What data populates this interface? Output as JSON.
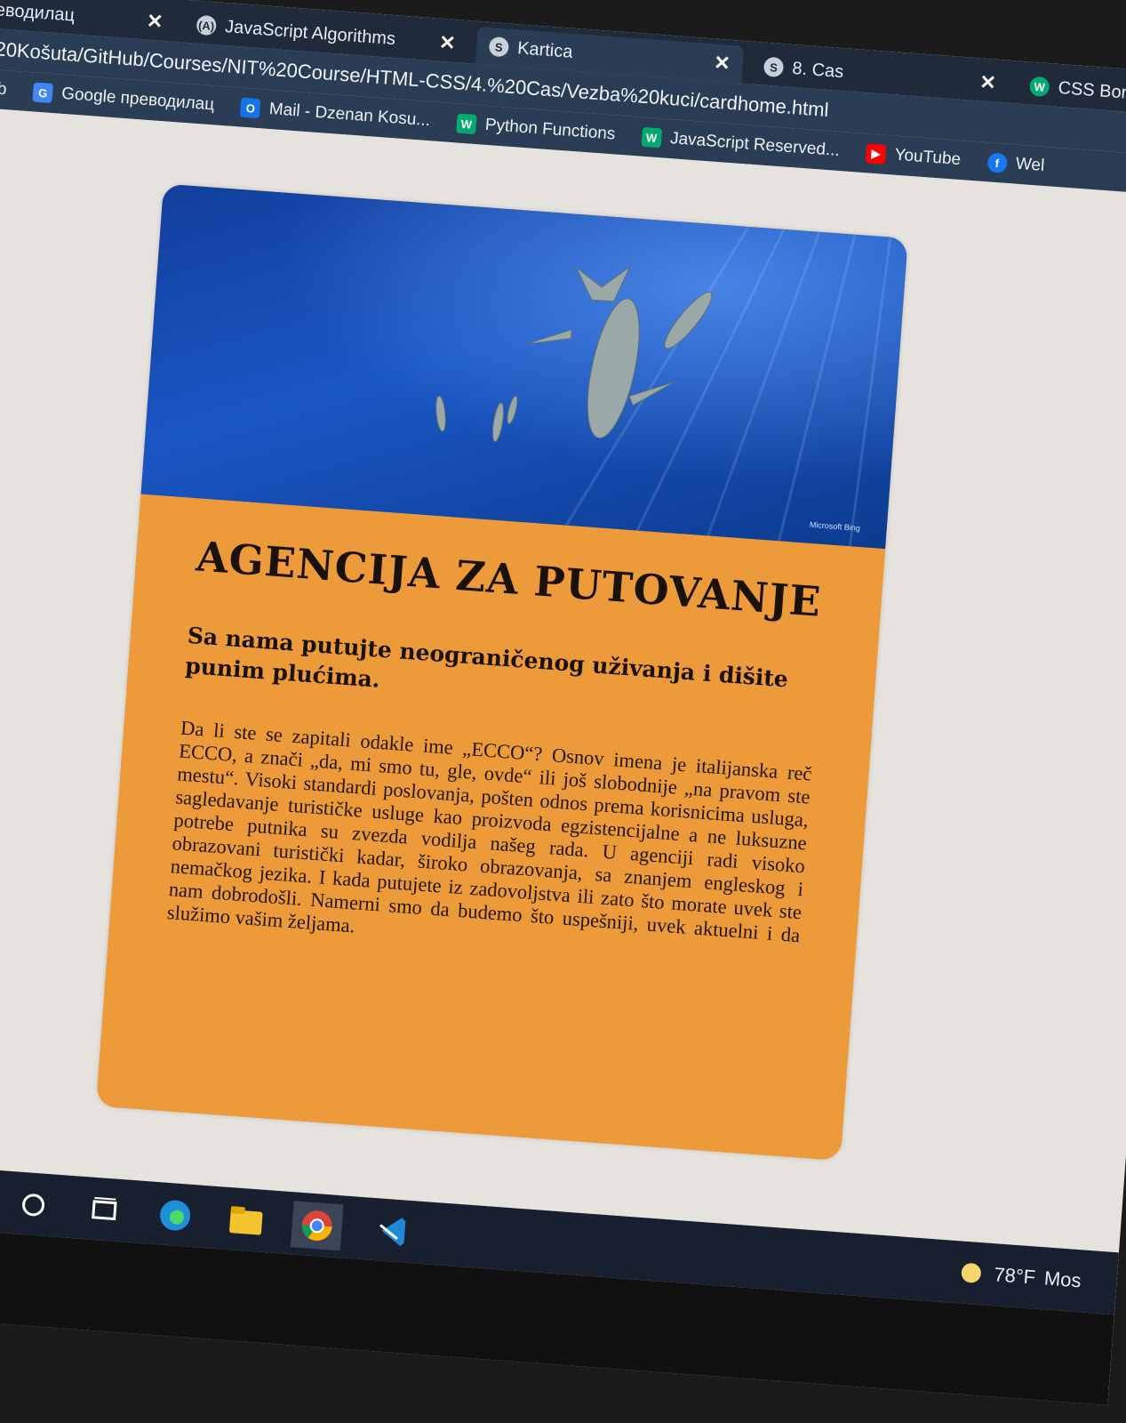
{
  "tabs": [
    {
      "label": "ie преводилац",
      "icon": "",
      "close": "✕"
    },
    {
      "label": "JavaScript Algorithms",
      "icon": "(A)",
      "close": "✕"
    },
    {
      "label": "Kartica",
      "icon": "S",
      "close": "✕"
    },
    {
      "label": "8. Cas",
      "icon": "S",
      "close": "✕"
    },
    {
      "label": "CSS Bord",
      "icon": "W",
      "close": ""
    }
  ],
  "address": {
    "url": "20Košuta/GitHub/Courses/NIT%20Course/HTML-CSS/4.%20Cas/Vezba%20kuci/cardhome.html"
  },
  "bookmarks": [
    {
      "label": "ub",
      "icon": "",
      "color": "#2b3d55"
    },
    {
      "label": "Google преводилац",
      "icon": "G",
      "color": "#4285f4"
    },
    {
      "label": "Mail - Dzenan Kosu...",
      "icon": "O",
      "color": "#1473e6"
    },
    {
      "label": "Python Functions",
      "icon": "W",
      "color": "#04aa6d"
    },
    {
      "label": "JavaScript Reserved...",
      "icon": "W",
      "color": "#04aa6d"
    },
    {
      "label": "YouTube",
      "icon": "▶",
      "color": "#ff0000"
    },
    {
      "label": "Wel",
      "icon": "f",
      "color": "#1877f2"
    }
  ],
  "card": {
    "image_watermark": "Microsoft Bing",
    "title": "AGENCIJA ZA PUTOVANJE",
    "subtitle": "Sa nama putujte neograničenog uživanja i dišite punim plućima.",
    "text": "Da li ste se zapitali odakle ime „ECCO“? Osnov imena je italijanska reč ECCO, a znači „da, mi smo tu, gle, ovde“ ili još slobodnije „na pravom ste mestu“. Visoki standardi poslovanja, pošten odnos prema korisnicima usluga, sagledavanje turističke usluge kao proizvoda egzistencijalne a ne luksuzne potrebe putnika su zvezda vodilja našeg rada. U agenciji radi visoko obrazovani turistički kadar, široko obrazovanja, sa znanjem engleskog i nemačkog jezika. I kada putujete iz zadovoljstva ili zato što morate uvek ste nam dobrodošli. Namerni smo da budemo što uspešniji, uvek aktuelni i da služimo vašim željama.",
    "background_color": "#ed9a3b"
  },
  "taskbar": {
    "weather": "78°F",
    "weather_extra": "Mos"
  }
}
